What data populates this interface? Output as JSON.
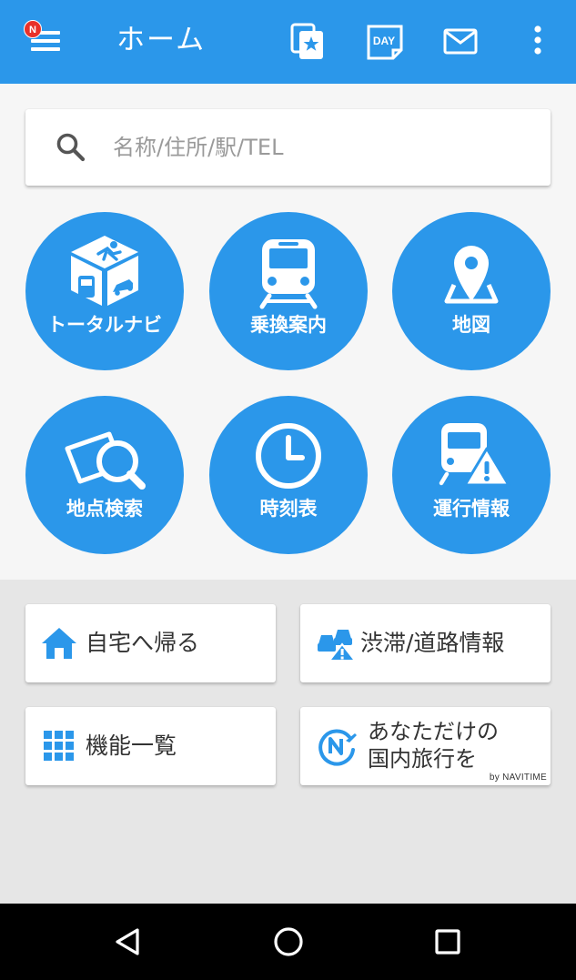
{
  "app_bar": {
    "title": "ホーム",
    "notification_badge": "N",
    "actions": [
      {
        "icon": "favorites-star-icon",
        "name": "favorites-button"
      },
      {
        "icon": "day-calendar-icon",
        "name": "day-button",
        "text": "DAY"
      },
      {
        "icon": "mail-icon",
        "name": "mail-button"
      },
      {
        "icon": "more-vert-icon",
        "name": "more-options-button"
      }
    ]
  },
  "search": {
    "placeholder": "名称/住所/駅/TEL",
    "value": ""
  },
  "main_buttons": [
    {
      "label": "トータルナビ",
      "icon": "total-navi-cube-icon"
    },
    {
      "label": "乗換案内",
      "icon": "train-icon"
    },
    {
      "label": "地図",
      "icon": "map-pin-icon"
    },
    {
      "label": "地点検索",
      "icon": "map-search-icon"
    },
    {
      "label": "時刻表",
      "icon": "clock-icon"
    },
    {
      "label": "運行情報",
      "icon": "train-warning-icon"
    }
  ],
  "cards": [
    {
      "label": "自宅へ帰る",
      "icon": "home-icon"
    },
    {
      "label": "渋滞/道路情報",
      "icon": "traffic-cars-warning-icon"
    },
    {
      "label": "機能一覧",
      "icon": "grid-icon"
    },
    {
      "label": "あなただけの",
      "label_line2": "国内旅行を",
      "byline": "by NAVITIME",
      "icon": "navitime-travel-icon"
    }
  ],
  "colors": {
    "primary": "#2b97ea",
    "badge": "#e8312a",
    "nav_bar": "#000000"
  },
  "nav_bar": {
    "buttons": [
      "back-icon",
      "home-circle-icon",
      "recents-square-icon"
    ]
  }
}
